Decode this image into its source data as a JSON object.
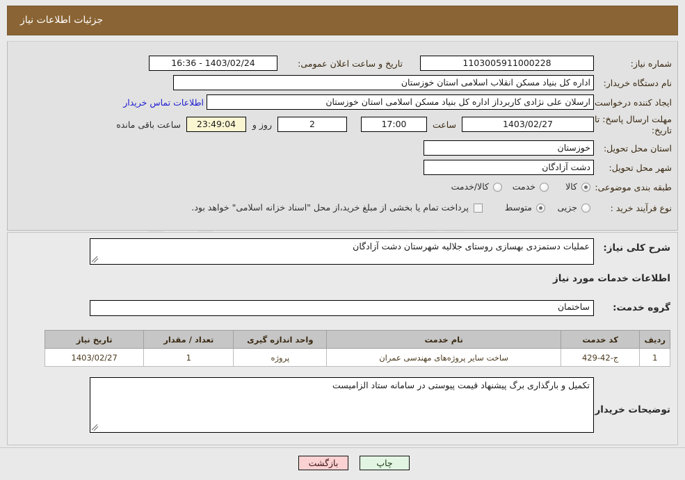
{
  "header": {
    "title": "جزئیات اطلاعات نیاز"
  },
  "form": {
    "need_number_label": "شماره نیاز:",
    "need_number_value": "1103005911000228",
    "announce_label": "تاریخ و ساعت اعلان عمومی:",
    "announce_value": "1403/02/24 - 16:36",
    "buyer_org_label": "نام دستگاه خریدار:",
    "buyer_org_value": "اداره کل بنیاد مسکن انقلاب اسلامی استان خوزستان",
    "requester_label": "ایجاد کننده درخواست:",
    "requester_value": "ارسلان علی نژادی کاربرداز اداره کل بنیاد مسکن اسلامی استان خوزستان",
    "buyer_contact_link": "اطلاعات تماس خریدار",
    "deadline_label_line1": "مهلت ارسال پاسخ: تا",
    "deadline_label_line2": "تاریخ:",
    "deadline_date": "1403/02/27",
    "hour_label": "ساعت",
    "deadline_time": "17:00",
    "remaining_days": "2",
    "days_and_label": "روز و",
    "remaining_clock": "23:49:04",
    "remaining_suffix": "ساعت باقی مانده",
    "province_label": "استان محل تحویل:",
    "province_value": "خوزستان",
    "city_label": "شهر محل تحویل:",
    "city_value": "دشت آزادگان",
    "category_label": "طبقه بندی موضوعی:",
    "category_options": [
      "کالا",
      "خدمت",
      "کالا/خدمت"
    ],
    "category_selected_index": 1,
    "process_label": "نوع فرآیند خرید :",
    "process_options": [
      "جزیی",
      "متوسط"
    ],
    "process_selected_index": 1,
    "treasury_note": "پرداخت تمام یا بخشی از مبلغ خرید،از محل \"اسناد خزانه اسلامی\" خواهد بود."
  },
  "lower": {
    "summary_label": "شرح کلی نیاز:",
    "summary_value": "عملیات دستمزدی بهسازی روستای جلالیه شهرستان دشت آزادگان",
    "services_heading": "اطلاعات خدمات مورد نیاز",
    "service_group_label": "گروه خدمت:",
    "service_group_value": "ساختمان",
    "buyer_notes_label": "توضیحات خریدار:",
    "buyer_notes_value": "تکمیل و بارگذاری برگ پیشنهاد قیمت پیوستی در سامانه ستاد الزامیست"
  },
  "table": {
    "headers": [
      "ردیف",
      "کد خدمت",
      "نام خدمت",
      "واحد اندازه گیری",
      "تعداد / مقدار",
      "تاریخ نیاز"
    ],
    "rows": [
      {
        "index": "1",
        "code": "ج-42-429",
        "name": "ساخت سایر پروژه‌های مهندسی عمران",
        "unit": "پروژه",
        "qty": "1",
        "date": "1403/02/27"
      }
    ]
  },
  "buttons": {
    "print": "چاپ",
    "back": "بازگشت"
  },
  "watermark": {
    "text": "AriaTender.net"
  },
  "colors": {
    "header_brown": "#8a6434",
    "panel_gray": "#e2e2e2",
    "link_blue": "#1b1bd2",
    "highlight_yellow": "#fbf6d2",
    "print_green": "#e2f5e2",
    "back_pink": "#fbd2d2"
  }
}
